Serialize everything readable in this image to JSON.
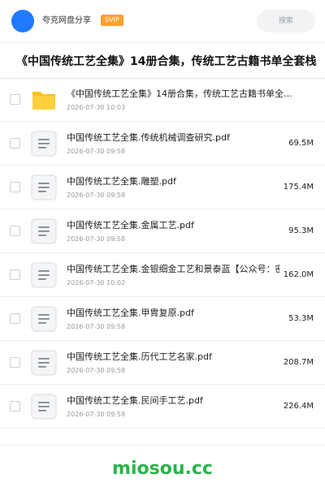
{
  "header": {
    "username": "夸克网盘分享",
    "badge": "SVIP",
    "search_placeholder": "搜索",
    "avatar_color": "#1f7aff"
  },
  "share": {
    "title": "《中国传统工艺全集》14册合集，传统工艺古籍书单全套栈"
  },
  "files": [
    {
      "type": "folder",
      "icon": "folder-icon",
      "name": "《中国传统工艺全集》14册合集，传统工艺古籍书单全…",
      "date": "2026-07-30 10:03",
      "size": ""
    },
    {
      "type": "pdf",
      "icon": "document-icon",
      "name": "中国传统工艺全集.传统机械调查研究.pdf",
      "date": "2026-07-30 09:58",
      "size": "69.5M"
    },
    {
      "type": "pdf",
      "icon": "document-icon",
      "name": "中国传统工艺全集.雕塑.pdf",
      "date": "2026-07-30 09:58",
      "size": "175.4M"
    },
    {
      "type": "pdf",
      "icon": "document-icon",
      "name": "中国传统工艺全集.金属工艺.pdf",
      "date": "2026-07-30 09:58",
      "size": "95.3M"
    },
    {
      "type": "pdf",
      "icon": "document-icon",
      "name": "中国传统工艺全集.金银细金工艺和景泰蓝【公众号：密",
      "date": "2026-07-30 10:02",
      "size": "162.0M"
    },
    {
      "type": "pdf",
      "icon": "document-icon",
      "name": "中国传统工艺全集.甲胄复原.pdf",
      "date": "2026-07-30 09:58",
      "size": "53.3M"
    },
    {
      "type": "pdf",
      "icon": "document-icon",
      "name": "中国传统工艺全集.历代工艺名家.pdf",
      "date": "2026-07-30 09:58",
      "size": "208.7M"
    },
    {
      "type": "pdf",
      "icon": "document-icon",
      "name": "中国传统工艺全集.民间手工艺.pdf",
      "date": "2026-07-30 09:58",
      "size": "226.4M"
    }
  ],
  "watermark": "miosou.cc",
  "colors": {
    "badge": "#ffa030",
    "folder": "#ffc21a",
    "watermark": "#2ab34a"
  }
}
